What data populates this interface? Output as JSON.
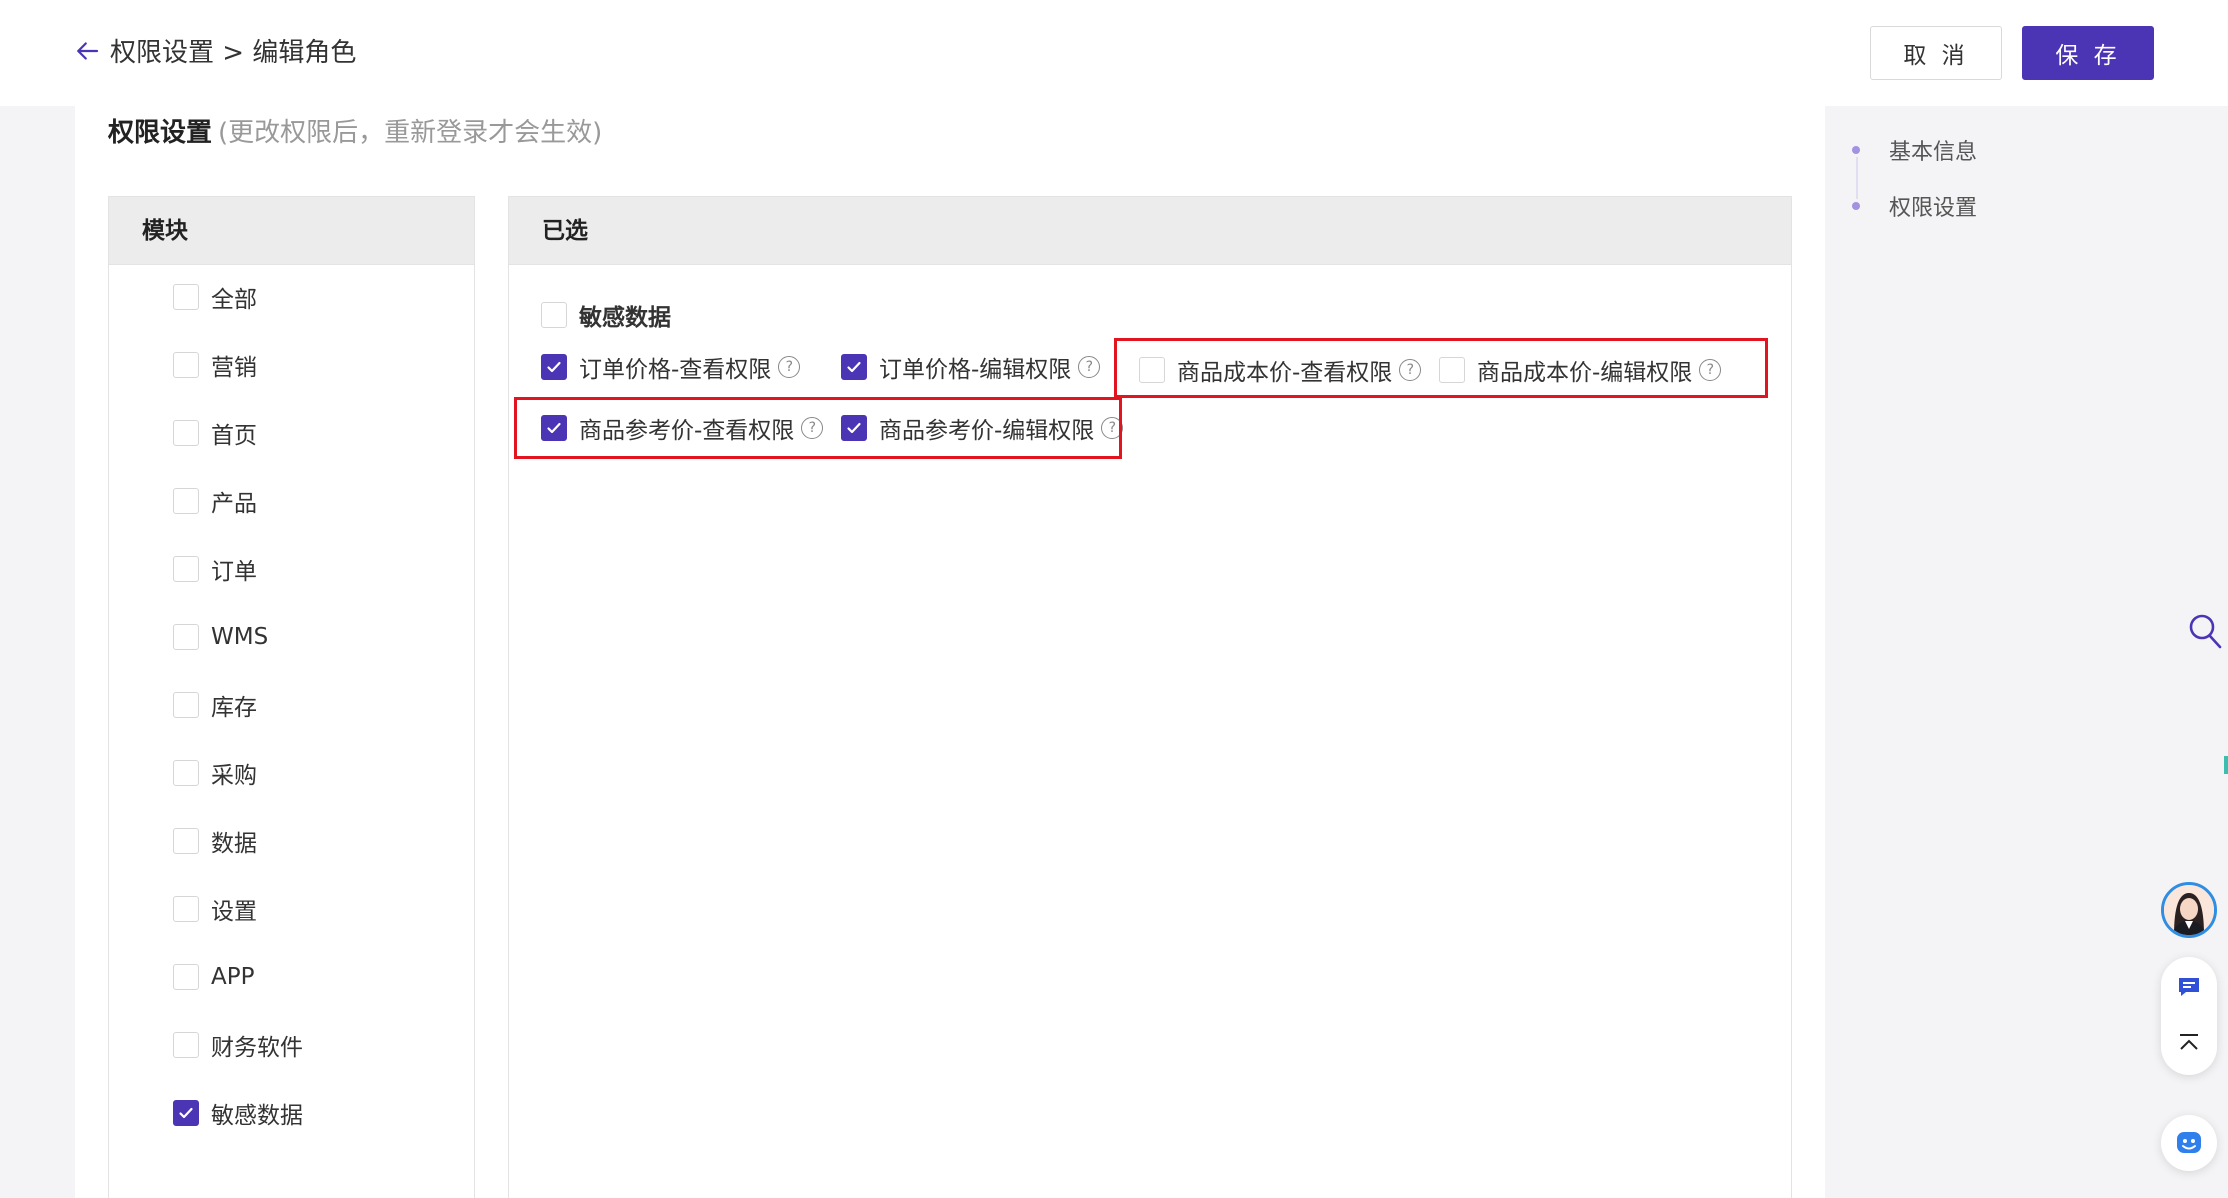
{
  "header": {
    "breadcrumb": "权限设置 > 编辑角色",
    "cancel_label": "取 消",
    "save_label": "保 存"
  },
  "section": {
    "title": "权限设置",
    "note": "(更改权限后，重新登录才会生效)"
  },
  "modules": {
    "header": "模块",
    "items": [
      {
        "label": "全部",
        "checked": false
      },
      {
        "label": "营销",
        "checked": false
      },
      {
        "label": "首页",
        "checked": false
      },
      {
        "label": "产品",
        "checked": false
      },
      {
        "label": "订单",
        "checked": false
      },
      {
        "label": "WMS",
        "checked": false
      },
      {
        "label": "库存",
        "checked": false
      },
      {
        "label": "采购",
        "checked": false
      },
      {
        "label": "数据",
        "checked": false
      },
      {
        "label": "设置",
        "checked": false
      },
      {
        "label": "APP",
        "checked": false
      },
      {
        "label": "财务软件",
        "checked": false
      },
      {
        "label": "敏感数据",
        "checked": true
      }
    ]
  },
  "selected": {
    "header": "已选",
    "group_label": "敏感数据",
    "group_checked": false,
    "permissions": [
      {
        "label": "订单价格-查看权限",
        "checked": true
      },
      {
        "label": "订单价格-编辑权限",
        "checked": true
      },
      {
        "label": "商品成本价-查看权限",
        "checked": false
      },
      {
        "label": "商品成本价-编辑权限",
        "checked": false
      },
      {
        "label": "商品参考价-查看权限",
        "checked": true
      },
      {
        "label": "商品参考价-编辑权限",
        "checked": true
      }
    ],
    "help_glyph": "?"
  },
  "anchors": {
    "items": [
      {
        "label": "基本信息"
      },
      {
        "label": "权限设置"
      }
    ]
  },
  "colors": {
    "accent": "#4c35b5",
    "highlight_border": "#e2141f"
  },
  "icons": {
    "back": "arrow-left-icon",
    "search": "search-icon",
    "avatar": "customer-service-avatar",
    "chat": "chat-icon",
    "top": "back-to-top-icon",
    "assistant": "assistant-smile-icon"
  }
}
